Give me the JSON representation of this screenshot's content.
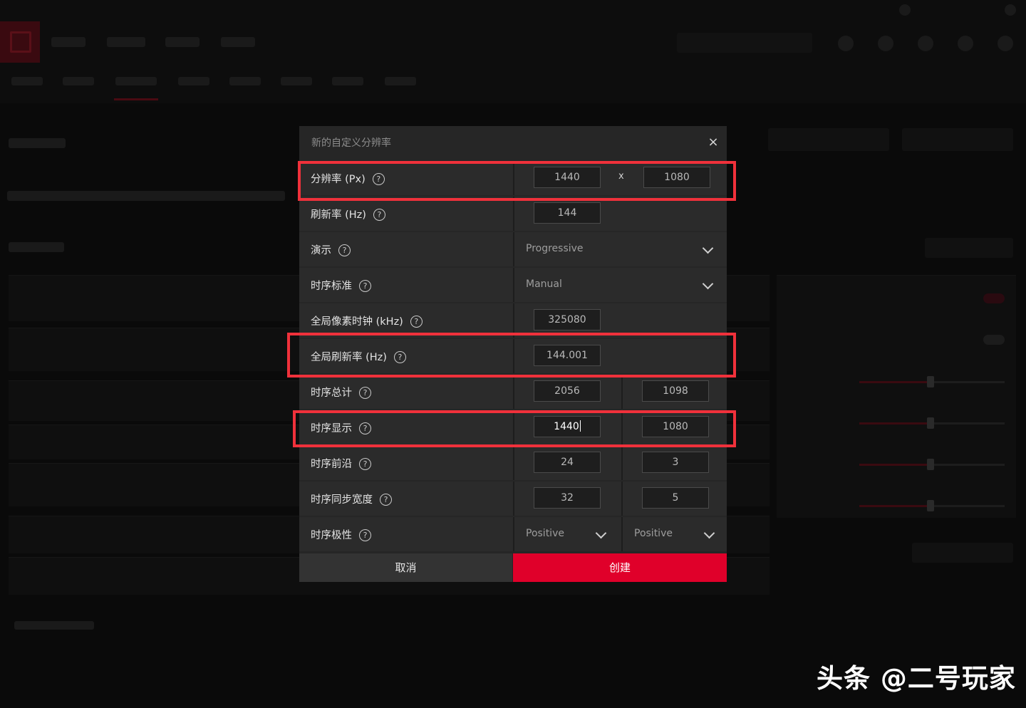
{
  "dialog": {
    "title": "新的自定义分辨率",
    "close_glyph": "×",
    "rows": {
      "resolution": {
        "label": "分辨率 (Px)",
        "width": "1440",
        "separator": "x",
        "height": "1080"
      },
      "refresh": {
        "label": "刷新率 (Hz)",
        "value": "144"
      },
      "presentation": {
        "label": "演示",
        "value": "Progressive"
      },
      "timing_standard": {
        "label": "时序标准",
        "value": "Manual"
      },
      "pixel_clock": {
        "label": "全局像素时钟 (kHz)",
        "value": "325080"
      },
      "global_refresh": {
        "label": "全局刷新率 (Hz)",
        "value": "144.001"
      },
      "timing_total": {
        "label": "时序总计",
        "h": "2056",
        "v": "1098"
      },
      "timing_display": {
        "label": "时序显示",
        "h": "1440",
        "v": "1080"
      },
      "front_porch": {
        "label": "时序前沿",
        "h": "24",
        "v": "3"
      },
      "sync_width": {
        "label": "时序同步宽度",
        "h": "32",
        "v": "5"
      },
      "polarity": {
        "label": "时序极性",
        "h": "Positive",
        "v": "Positive"
      }
    },
    "help_glyph": "?",
    "cancel_label": "取消",
    "create_label": "创建"
  },
  "colors": {
    "accent": "#e0002a",
    "highlight": "#f0313b",
    "dialog_bg": "#262626"
  },
  "watermark": "头条 @二号玩家"
}
